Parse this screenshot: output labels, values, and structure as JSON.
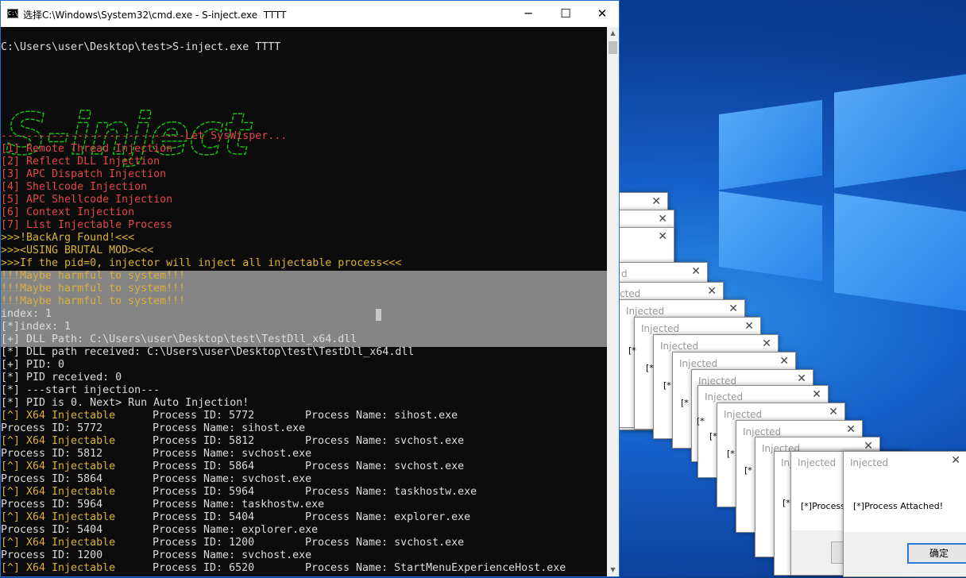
{
  "window": {
    "title": "选择C:\\Windows\\System32\\cmd.exe - S-inject.exe  TTTT",
    "minimize": "─",
    "maximize": "☐",
    "close": "✕"
  },
  "console": {
    "command": "C:\\Users\\user\\Desktop\\test>S-inject.exe TTTT",
    "logo_text": "S-inject",
    "banner": "-----------------------------Let SysWisper...",
    "menu": [
      "[1] Remote Thread Injection",
      "[2] Reflect DLL Injection",
      "[3] APC Dispatch Injection",
      "[4] Shellcode Injection",
      "[5] APC Shellcode Injection",
      "[6] Context Injection",
      "[7] List Injectable Process"
    ],
    "warnings": [
      ">>>!BackArg Found!<<<",
      ">>><USING BRUTAL MOD><<<",
      ">>>If the pid=0, injector will inject all injectable process<<<",
      "!!!Maybe harmful to system!!!",
      "!!!Maybe harmful to system!!!",
      "!!!Maybe harmful to system!!!"
    ],
    "log": [
      "index: 1",
      "[*]index: 1",
      "[+] DLL Path: C:\\Users\\user\\Desktop\\test\\TestDll_x64.dll",
      "[*] DLL path received: C:\\Users\\user\\Desktop\\test\\TestDll_x64.dll",
      "[+] PID: 0",
      "[*] PID received: 0",
      "[*] ---start injection---",
      "[*] PID is 0. Next> Run Auto Injection!"
    ],
    "injectables": [
      {
        "tag": "[^] X64 Injectable",
        "pid_label": "Process ID: 5772",
        "name_label": "Process Name: sihost.exe",
        "pid2": "Process ID: 5772",
        "name2": "Process Name: sihost.exe"
      },
      {
        "tag": "[^] X64 Injectable",
        "pid_label": "Process ID: 5812",
        "name_label": "Process Name: svchost.exe",
        "pid2": "Process ID: 5812",
        "name2": "Process Name: svchost.exe"
      },
      {
        "tag": "[^] X64 Injectable",
        "pid_label": "Process ID: 5864",
        "name_label": "Process Name: svchost.exe",
        "pid2": "Process ID: 5864",
        "name2": "Process Name: svchost.exe"
      },
      {
        "tag": "[^] X64 Injectable",
        "pid_label": "Process ID: 5964",
        "name_label": "Process Name: taskhostw.exe",
        "pid2": "Process ID: 5964",
        "name2": "Process Name: taskhostw.exe"
      },
      {
        "tag": "[^] X64 Injectable",
        "pid_label": "Process ID: 5404",
        "name_label": "Process Name: explorer.exe",
        "pid2": "Process ID: 5404",
        "name2": "Process Name: explorer.exe"
      },
      {
        "tag": "[^] X64 Injectable",
        "pid_label": "Process ID: 1200",
        "name_label": "Process Name: svchost.exe",
        "pid2": "Process ID: 1200",
        "name2": "Process Name: svchost.exe"
      },
      {
        "tag": "[^] X64 Injectable",
        "pid_label": "Process ID: 6520",
        "name_label": "Process Name: StartMenuExperienceHost.exe"
      }
    ]
  },
  "dialogs": {
    "title": "Injected",
    "title_partial_1": "cted",
    "title_partial_2": "d",
    "title_partial_3": "Inj",
    "message": "[*]Process Attached!",
    "message_partial": "[*]Process",
    "message_stub": "[*",
    "close": "✕",
    "ok_button": "确定"
  },
  "colors": {
    "console_bg": "#0c0c0c",
    "menu_red": "#e04848",
    "warning_yellow": "#d9b13a",
    "logo_green": "#16c60c",
    "selection": "#858585"
  }
}
